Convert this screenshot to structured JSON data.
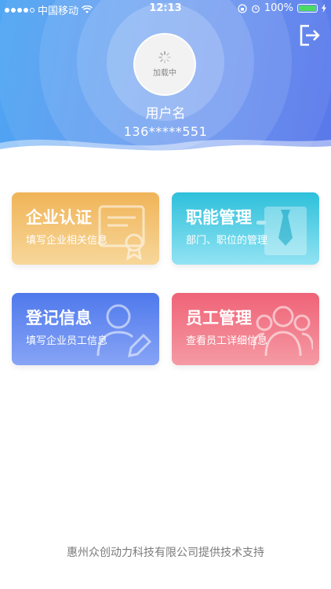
{
  "status_bar": {
    "carrier": "中国移动",
    "time": "12:13",
    "battery": "100%"
  },
  "profile": {
    "loading_text": "加载中",
    "username": "用户名",
    "phone": "136*****551"
  },
  "cards": [
    {
      "title": "企业认证",
      "subtitle": "填写企业相关信息",
      "icon": "certificate-icon",
      "color": "#f0b458"
    },
    {
      "title": "职能管理",
      "subtitle": "部门、职位的管理",
      "icon": "badge-tie-icon",
      "color": "#2ec0db"
    },
    {
      "title": "登记信息",
      "subtitle": "填写企业员工信息",
      "icon": "user-edit-icon",
      "color": "#4f79ec"
    },
    {
      "title": "员工管理",
      "subtitle": "查看员工详细信息",
      "icon": "group-icon",
      "color": "#ef6377"
    }
  ],
  "footer": {
    "text": "惠州众创动力科技有限公司提供技术支持"
  }
}
